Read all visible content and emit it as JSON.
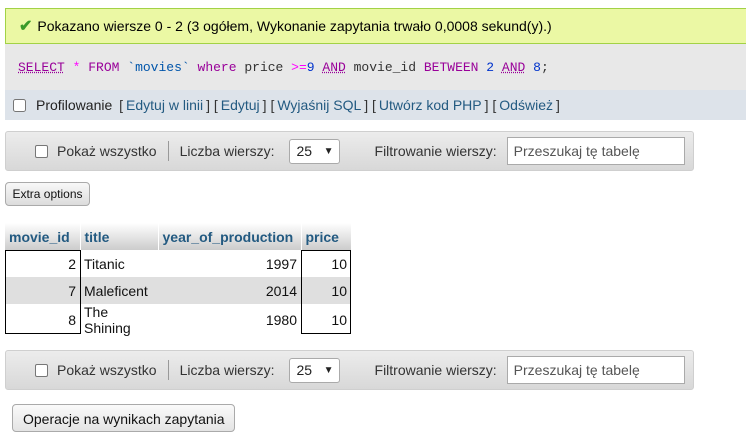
{
  "status": {
    "icon": "check-icon",
    "message": "Pokazano wiersze 0 - 2 (3 ogółem, Wykonanie zapytania trwało 0,0008 sekund(y).)"
  },
  "sql": {
    "select": "SELECT",
    "star": "*",
    "from": "FROM",
    "table": "`movies`",
    "where": "where",
    "col1": "price",
    "op": ">=",
    "val1": "9",
    "and1": "AND",
    "col2": "movie_id",
    "between": "BETWEEN",
    "val2": "2",
    "and2": "AND",
    "val3": "8",
    "end": ";"
  },
  "query_links": {
    "profiling_label": "Profilowanie",
    "edit_inline": "Edytuj w linii",
    "edit": "Edytuj",
    "explain": "Wyjaśnij SQL",
    "create_php": "Utwórz kod PHP",
    "refresh": "Odśwież"
  },
  "navigation": {
    "show_all": "Pokaż wszystko",
    "rows_label": "Liczba wierszy:",
    "rows_value": "25",
    "filter_label": "Filtrowanie wierszy:",
    "filter_placeholder": "Przeszukaj tę tabelę"
  },
  "extra_options_label": "Extra options",
  "table": {
    "columns": [
      "movie_id",
      "title",
      "year_of_production",
      "price"
    ],
    "rows": [
      [
        "2",
        "Titanic",
        "1997",
        "10"
      ],
      [
        "7",
        "Maleficent",
        "2014",
        "10"
      ],
      [
        "8",
        "The Shining",
        "1980",
        "10"
      ]
    ]
  },
  "operations_label": "Operacje na wynikach zapytania"
}
